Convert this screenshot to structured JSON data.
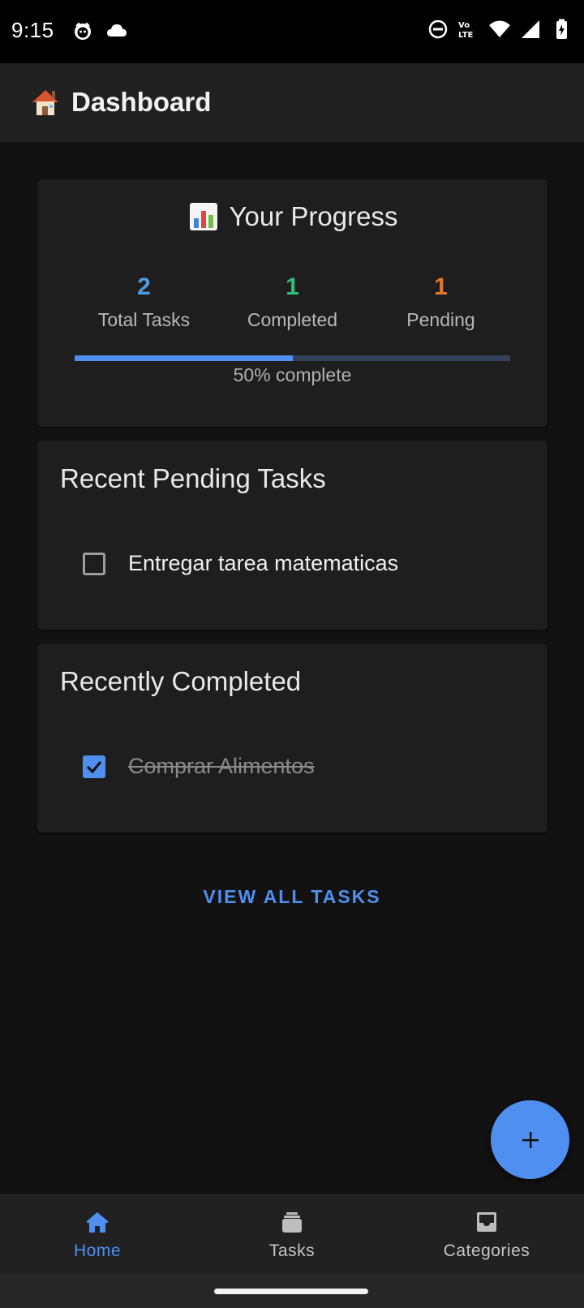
{
  "status_bar": {
    "time": "9:15",
    "left_icons": [
      "face-icon",
      "cloud-icon"
    ],
    "right_icons": [
      "do-not-disturb-icon",
      "volte-icon",
      "wifi-icon",
      "signal-icon",
      "battery-icon"
    ]
  },
  "app_bar": {
    "title": "Dashboard",
    "icon": "house-icon"
  },
  "progress_card": {
    "title": "Your Progress",
    "icon": "bar-chart-icon",
    "stats": [
      {
        "value": "2",
        "label": "Total Tasks",
        "color": "#4a9be0"
      },
      {
        "value": "1",
        "label": "Completed",
        "color": "#2fbf71"
      },
      {
        "value": "1",
        "label": "Pending",
        "color": "#e07a2b"
      }
    ],
    "progress_percent": 50,
    "progress_text": "50% complete"
  },
  "pending_card": {
    "title": "Recent Pending Tasks",
    "tasks": [
      {
        "label": "Entregar tarea matematicas",
        "checked": false
      }
    ]
  },
  "completed_card": {
    "title": "Recently Completed",
    "tasks": [
      {
        "label": "Comprar Alimentos",
        "checked": true
      }
    ]
  },
  "view_all_label": "VIEW ALL TASKS",
  "fab": {
    "icon": "plus-icon"
  },
  "bottom_nav": {
    "items": [
      {
        "label": "Home",
        "icon": "home-icon",
        "active": true
      },
      {
        "label": "Tasks",
        "icon": "tasks-stack-icon",
        "active": false
      },
      {
        "label": "Categories",
        "icon": "inbox-icon",
        "active": false
      }
    ]
  },
  "colors": {
    "accent": "#4f8ff0",
    "background": "#121212",
    "card": "#1e1e1e"
  }
}
